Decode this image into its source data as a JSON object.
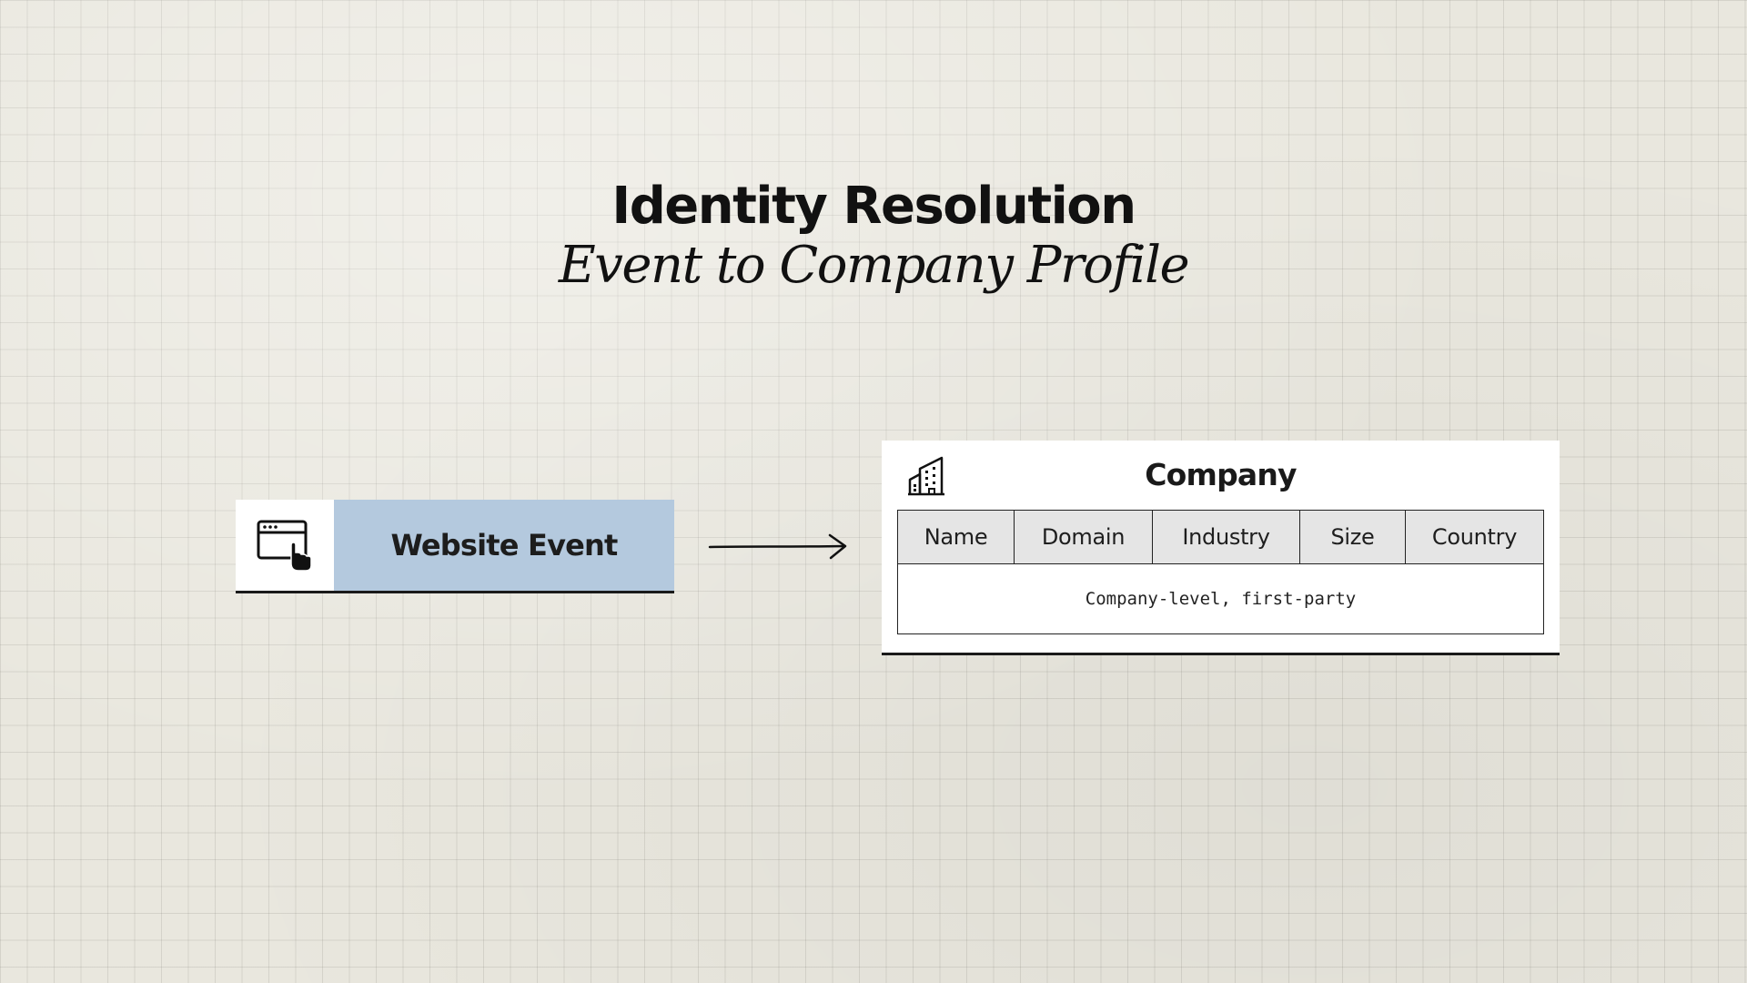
{
  "header": {
    "title": "Identity Resolution",
    "subtitle": "Event to Company Profile"
  },
  "source": {
    "icon": "browser-click-icon",
    "label": "Website Event",
    "accent_color": "#b4c9de"
  },
  "connector": {
    "icon": "arrow-right-icon"
  },
  "target": {
    "icon": "building-icon",
    "title": "Company",
    "columns": [
      "Name",
      "Domain",
      "Industry",
      "Size",
      "Country"
    ],
    "note": "Company-level, first-party"
  }
}
